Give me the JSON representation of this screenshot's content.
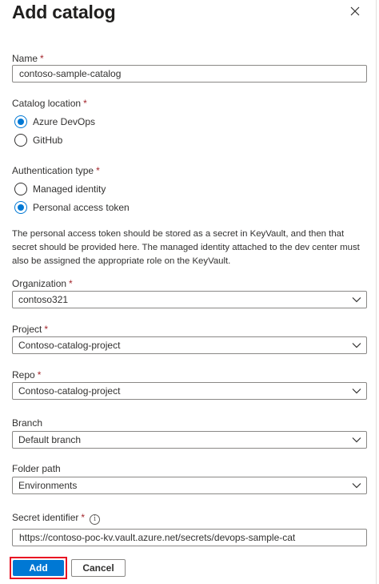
{
  "panel": {
    "title": "Add catalog"
  },
  "name": {
    "label": "Name",
    "required_mark": "*",
    "value": "contoso-sample-catalog"
  },
  "catalog_location": {
    "label": "Catalog location",
    "required_mark": "*",
    "options": [
      {
        "label": "Azure DevOps",
        "selected": true
      },
      {
        "label": "GitHub",
        "selected": false
      }
    ]
  },
  "authentication_type": {
    "label": "Authentication type",
    "required_mark": "*",
    "options": [
      {
        "label": "Managed identity",
        "selected": false
      },
      {
        "label": "Personal access token",
        "selected": true
      }
    ]
  },
  "info_text": "The personal access token should be stored as a secret in KeyVault, and then that secret should be provided here. The managed identity attached to the dev center must also be assigned the appropriate role on the KeyVault.",
  "organization": {
    "label": "Organization",
    "required_mark": "*",
    "value": "contoso321"
  },
  "project": {
    "label": "Project",
    "required_mark": "*",
    "value": "Contoso-catalog-project"
  },
  "repo": {
    "label": "Repo",
    "required_mark": "*",
    "value": "Contoso-catalog-project"
  },
  "branch": {
    "label": "Branch",
    "value": "Default branch"
  },
  "folder_path": {
    "label": "Folder path",
    "value": "Environments"
  },
  "secret_identifier": {
    "label": "Secret identifier",
    "required_mark": "*",
    "info_glyph": "i",
    "value": "https://contoso-poc-kv.vault.azure.net/secrets/devops-sample-cat"
  },
  "buttons": {
    "add": "Add",
    "cancel": "Cancel"
  },
  "colors": {
    "accent": "#0078d4",
    "required": "#a4262c",
    "highlight_border": "#e81123",
    "input_border": "#8a8886"
  },
  "icons": {
    "close": "close-icon",
    "dropdown": "chevron-down-icon",
    "info": "info-icon"
  }
}
